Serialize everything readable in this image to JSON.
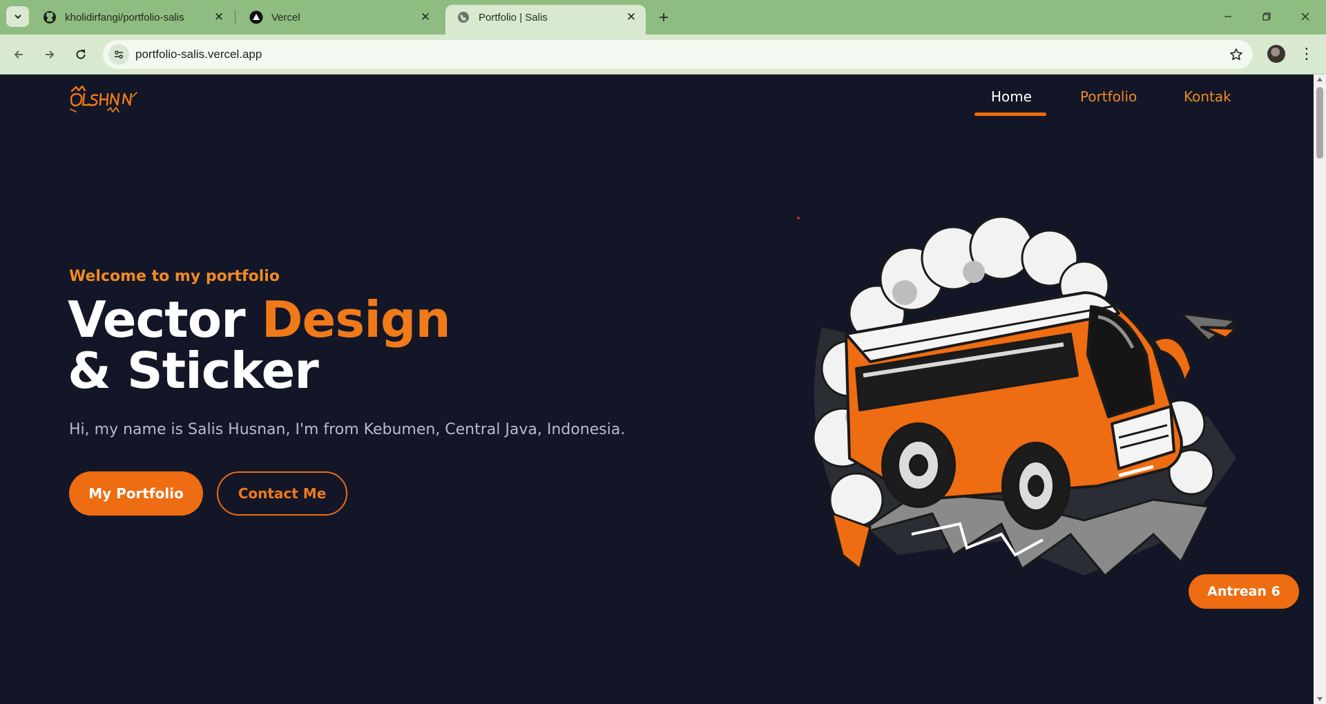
{
  "browser": {
    "tabs": [
      {
        "title": "kholidirfangi/portfolio-salis",
        "favicon": "github-icon",
        "active": false
      },
      {
        "title": "Vercel",
        "favicon": "vercel-icon",
        "active": false
      },
      {
        "title": "Portfolio | Salis",
        "favicon": "globe-icon",
        "active": true
      }
    ],
    "url": "portfolio-salis.vercel.app"
  },
  "site": {
    "logo_text": "OLSHSNN",
    "nav": [
      {
        "label": "Home",
        "active": true
      },
      {
        "label": "Portfolio",
        "active": false
      },
      {
        "label": "Kontak",
        "active": false
      }
    ],
    "hero": {
      "welcome": "Welcome to my portfolio",
      "headline_part1": "Vector ",
      "headline_accent": "Design",
      "headline_line2": "& Sticker",
      "intro": "Hi, my name is Salis Husnan, I'm from Kebumen, Central Java, Indonesia.",
      "primary_button": "My Portfolio",
      "secondary_button": "Contact Me",
      "illustration": "orange-bus-drifting-with-smoke"
    },
    "queue_button": "Antrean 6"
  },
  "colors": {
    "accent": "#ee6c12",
    "background": "#131627",
    "chrome": "#8fbc80"
  }
}
